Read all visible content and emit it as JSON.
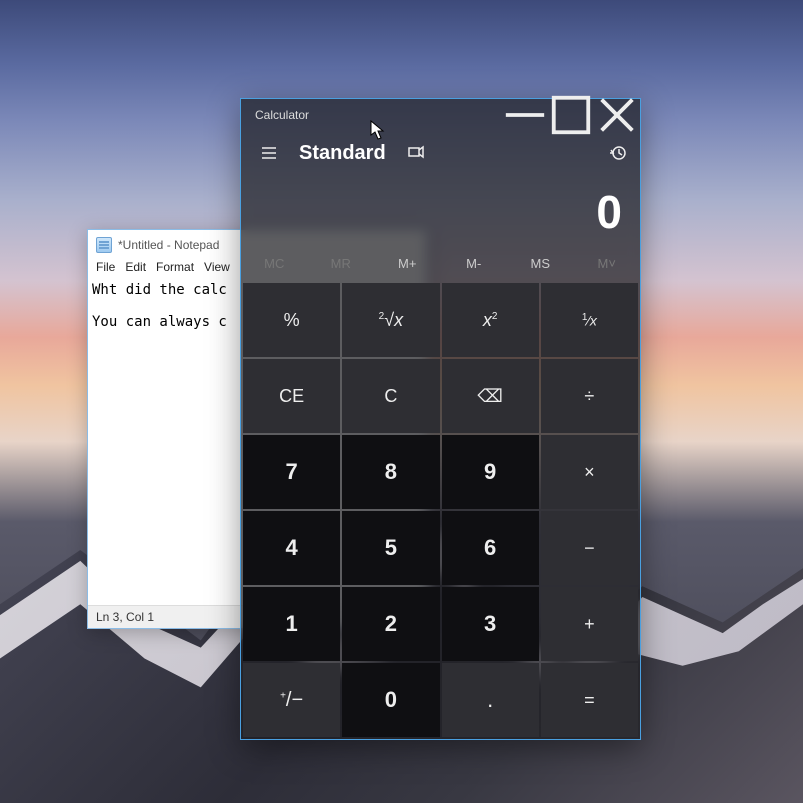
{
  "notepad": {
    "title": "*Untitled - Notepad",
    "menu": {
      "file": "File",
      "edit": "Edit",
      "format": "Format",
      "view": "View"
    },
    "content": "Wht did the calc\n\nYou can always c",
    "status": "Ln 3, Col 1"
  },
  "calculator": {
    "title": "Calculator",
    "mode": "Standard",
    "display": "0",
    "memory": {
      "mc": "MC",
      "mr": "MR",
      "mplus": "M+",
      "mminus": "M-",
      "ms": "MS",
      "mlist": "M˅"
    },
    "keys": {
      "percent": "%",
      "root": "²√x",
      "square": "x²",
      "recip": "¹⁄ₓ",
      "ce": "CE",
      "c": "C",
      "back": "⌫",
      "div": "÷",
      "k7": "7",
      "k8": "8",
      "k9": "9",
      "mul": "×",
      "k4": "4",
      "k5": "5",
      "k6": "6",
      "sub": "−",
      "k1": "1",
      "k2": "2",
      "k3": "3",
      "add": "+",
      "sign": "+/-",
      "k0": "0",
      "dot": ".",
      "eq": "="
    }
  }
}
